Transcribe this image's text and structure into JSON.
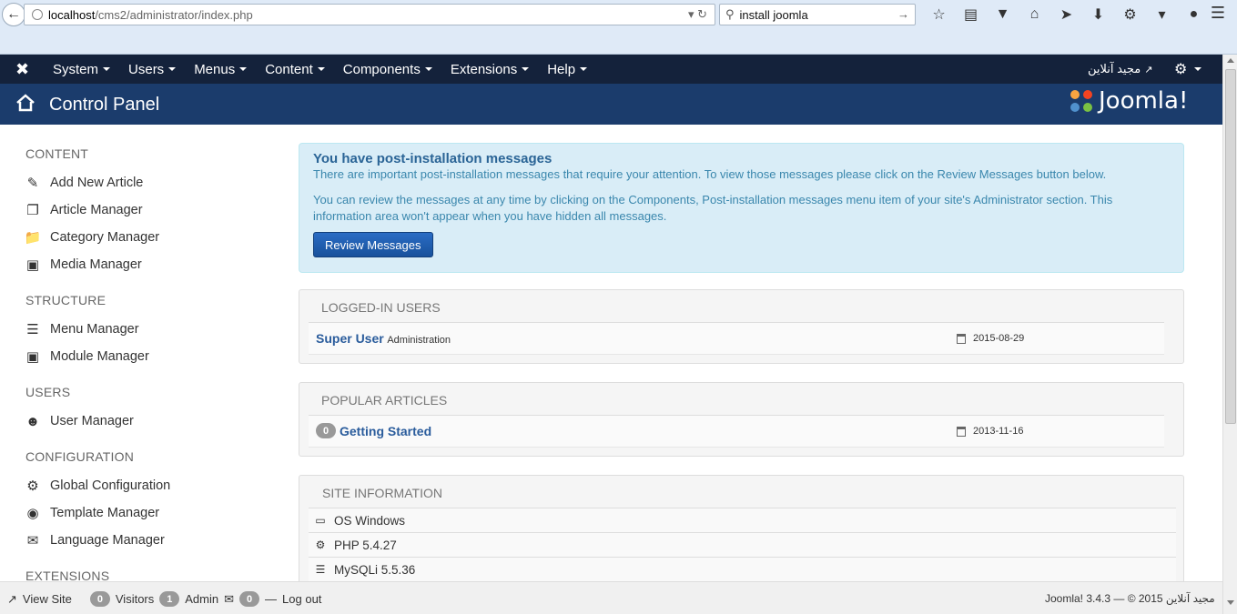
{
  "browser": {
    "url_host": "localhost",
    "url_path": "/cms2/administrator/index.php",
    "search_value": "install joomla",
    "toolbar_icons": [
      "star-icon",
      "reading-list-icon",
      "pocket-icon",
      "home-icon",
      "send-icon",
      "download-icon",
      "extension-icon",
      "dropdown-icon",
      "chat-icon",
      "menu-icon"
    ]
  },
  "nav": {
    "items": [
      "System",
      "Users",
      "Menus",
      "Content",
      "Components",
      "Extensions",
      "Help"
    ],
    "user_label": "مجید آنلاین"
  },
  "header": {
    "title": "Control Panel",
    "logo_text": "Joomla!"
  },
  "sidebar": {
    "sections": [
      {
        "heading": "CONTENT",
        "items": [
          "Add New Article",
          "Article Manager",
          "Category Manager",
          "Media Manager"
        ]
      },
      {
        "heading": "STRUCTURE",
        "items": [
          "Menu Manager",
          "Module Manager"
        ]
      },
      {
        "heading": "USERS",
        "items": [
          "User Manager"
        ]
      },
      {
        "heading": "CONFIGURATION",
        "items": [
          "Global Configuration",
          "Template Manager",
          "Language Manager"
        ]
      },
      {
        "heading": "EXTENSIONS",
        "items": []
      }
    ]
  },
  "alert": {
    "title": "You have post-installation messages",
    "p1": "There are important post-installation messages that require your attention. To view those messages please click on the Review Messages button below.",
    "p2": "You can review the messages at any time by clicking on the Components, Post-installation messages menu item of your site's Administrator section. This information area won't appear when you have hidden all messages.",
    "button": "Review Messages"
  },
  "logged_in": {
    "title": "LOGGED-IN USERS",
    "user": "Super User",
    "role": "Administration",
    "date": "2015-08-29"
  },
  "popular": {
    "title": "POPULAR ARTICLES",
    "hits": "0",
    "article": "Getting Started",
    "date": "2013-11-16"
  },
  "site_info": {
    "title": "SITE INFORMATION",
    "rows": [
      "OS Windows",
      "PHP 5.4.27",
      "MySQLi 5.5.36"
    ]
  },
  "status": {
    "view_site": "View Site",
    "visitors_count": "0",
    "visitors_label": "Visitors",
    "admin_count": "1",
    "admin_label": "Admin",
    "messages_count": "0",
    "logout": "Log out",
    "version": "Joomla! 3.4.3 — © 2015 مجید آنلاین"
  }
}
